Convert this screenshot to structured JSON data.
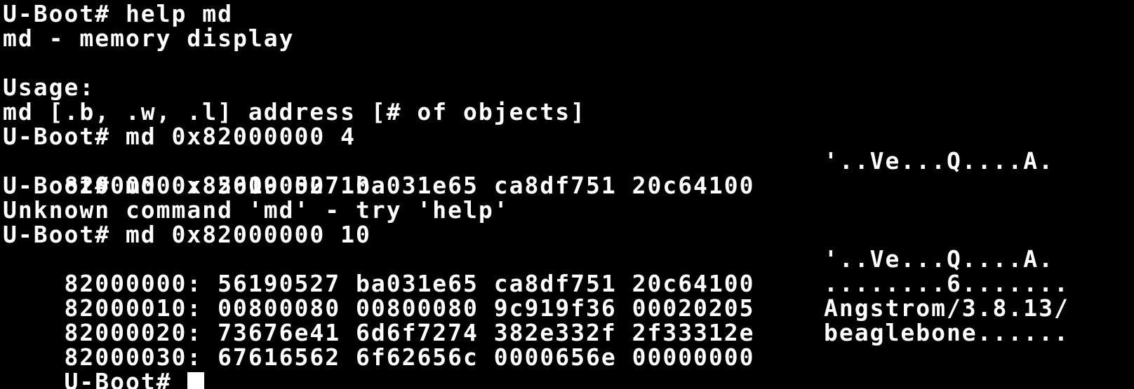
{
  "terminal": {
    "lines": [
      "U-Boot# help md",
      "md - memory display",
      "",
      "Usage:",
      "md [.b, .w, .l] address [# of objects]",
      "U-Boot# md 0x82000000 4"
    ],
    "dump1": [
      {
        "hex": "82000000: 56190527 ba031e65 ca8df751 20c64100",
        "ascii": "'..Ve...Q....A."
      }
    ],
    "lines2": [
      "U-Boot# md 0x82000000 10",
      "Unknown command 'md' - try 'help'",
      "U-Boot# md 0x82000000 10"
    ],
    "dump2": [
      {
        "hex": "82000000: 56190527 ba031e65 ca8df751 20c64100",
        "ascii": "'..Ve...Q....A."
      },
      {
        "hex": "82000010: 00800080 00800080 9c919f36 00020205",
        "ascii": "........6......."
      },
      {
        "hex": "82000020: 73676e41 6d6f7274 382e332f 2f33312e",
        "ascii": "Angstrom/3.8.13/"
      },
      {
        "hex": "82000030: 67616562 6f62656c 0000656e 00000000",
        "ascii": "beaglebone......"
      }
    ],
    "prompt": "U-Boot# "
  }
}
